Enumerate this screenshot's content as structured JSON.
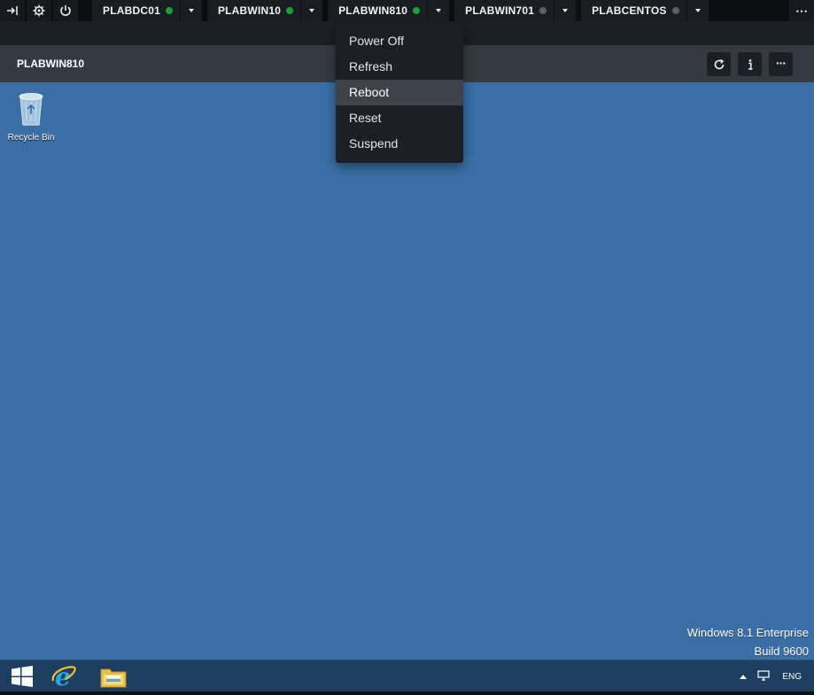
{
  "topbar": {
    "icons": [
      "exit-icon",
      "gear-icon",
      "power-icon"
    ],
    "tabs": [
      {
        "name": "PLABDC01",
        "status": "running",
        "dot_color": "#1e9e3a"
      },
      {
        "name": "PLABWIN10",
        "status": "running",
        "dot_color": "#1e9e3a"
      },
      {
        "name": "PLABWIN810",
        "status": "running",
        "dot_color": "#1e9e3a"
      },
      {
        "name": "PLABWIN701",
        "status": "stopped",
        "dot_color": "#5b5f66"
      },
      {
        "name": "PLABCENTOS",
        "status": "stopped",
        "dot_color": "#5b5f66"
      }
    ],
    "more_label": "⋯"
  },
  "vm_header": {
    "title": "PLABWIN810",
    "buttons": [
      "refresh-icon",
      "info-icon",
      "more-icon"
    ],
    "more_label": "···"
  },
  "dropdown": {
    "items": [
      {
        "label": "Power Off"
      },
      {
        "label": "Refresh"
      },
      {
        "label": "Reboot",
        "highlighted": true
      },
      {
        "label": "Reset"
      },
      {
        "label": "Suspend"
      }
    ]
  },
  "desktop": {
    "background": "#3a6ea5",
    "icons": [
      {
        "label": "Recycle Bin",
        "icon": "recycle-bin-icon"
      }
    ],
    "watermark_line1": "Windows 8.1 Enterprise",
    "watermark_line2": "Build 9600"
  },
  "taskbar": {
    "items": [
      "windows-start-icon",
      "internet-explorer-icon",
      "file-explorer-icon"
    ],
    "tray": {
      "language": "ENG"
    }
  }
}
